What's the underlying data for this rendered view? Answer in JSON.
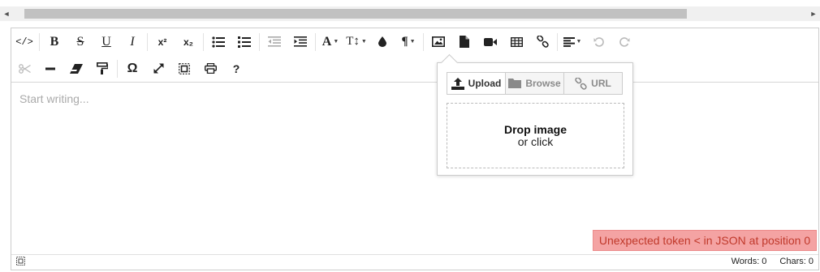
{
  "scrollbar": {
    "left_arrow": "◄",
    "right_arrow": "►"
  },
  "toolbar": {
    "row1": [
      {
        "name": "source-code-icon",
        "label": "</>"
      },
      {
        "name": "bold-button",
        "label": "B"
      },
      {
        "name": "strikethrough-button",
        "label": "S"
      },
      {
        "name": "underline-button",
        "label": "U"
      },
      {
        "name": "italic-button",
        "label": "I"
      },
      {
        "name": "superscript-button",
        "label": "x²"
      },
      {
        "name": "subscript-button",
        "label": "x₂"
      },
      {
        "name": "unordered-list-icon"
      },
      {
        "name": "ordered-list-icon"
      },
      {
        "name": "outdent-icon"
      },
      {
        "name": "indent-icon"
      },
      {
        "name": "font-family-button",
        "label": "A"
      },
      {
        "name": "font-size-button",
        "label": "T↕"
      },
      {
        "name": "color-drop-icon"
      },
      {
        "name": "paragraph-button",
        "label": "¶"
      },
      {
        "name": "image-icon"
      },
      {
        "name": "file-icon"
      },
      {
        "name": "video-icon"
      },
      {
        "name": "table-icon"
      },
      {
        "name": "link-icon"
      },
      {
        "name": "align-icon"
      },
      {
        "name": "undo-icon"
      },
      {
        "name": "redo-icon"
      }
    ],
    "row2": [
      {
        "name": "cut-icon"
      },
      {
        "name": "horizontal-line-icon"
      },
      {
        "name": "eraser-icon"
      },
      {
        "name": "paint-format-icon"
      },
      {
        "name": "special-char-button",
        "label": "Ω"
      },
      {
        "name": "fullscreen-icon"
      },
      {
        "name": "select-all-icon"
      },
      {
        "name": "print-icon"
      },
      {
        "name": "help-button",
        "label": "?"
      }
    ]
  },
  "editor": {
    "placeholder": "Start writing..."
  },
  "popup": {
    "tabs": [
      {
        "label": "Upload",
        "icon": "upload-icon"
      },
      {
        "label": "Browse",
        "icon": "folder-icon"
      },
      {
        "label": "URL",
        "icon": "link-icon"
      }
    ],
    "drop_title": "Drop image",
    "drop_subtitle": "or click"
  },
  "error_message": "Unexpected token < in JSON at position 0",
  "status": {
    "words": "Words: 0",
    "chars": "Chars: 0"
  }
}
